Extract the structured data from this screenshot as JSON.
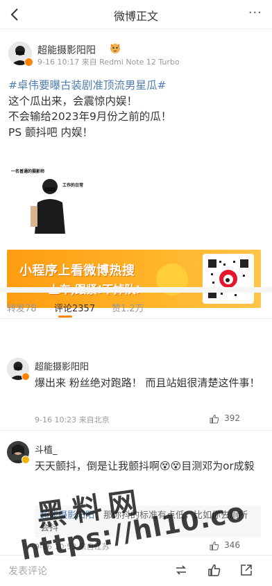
{
  "nav": {
    "title": "微博正文",
    "more": "···"
  },
  "post": {
    "author": "超能摄影阳阳",
    "meta": "9-16 10:17 来自 Redmi Note 12 Turbo",
    "topic": "#卓伟要曝古装剧准顶流男星瓜#",
    "lines": [
      "这个瓜出来，会震惊内娱！",
      "不会输给2023年9月份之前的瓜！",
      "PS 颤抖吧 内娱！"
    ],
    "image_caption_top": "一名普通的摄影师",
    "image_caption_right": "工作的日常"
  },
  "banner": {
    "line1": "小程序上看微博热搜",
    "line2": "上车,跟紧!不掉队!"
  },
  "tabs": {
    "repost": "转发78",
    "comments": "评论2357",
    "likes": "赞1.2万"
  },
  "comments": [
    {
      "name": "超能摄影阳阳",
      "text": "爆出来 粉丝绝对跑路！ 而且站姐很清楚这件事！",
      "meta": "9-16 10:23 来自北京",
      "likes": "392"
    },
    {
      "name": "斗植_",
      "text": "天天颤抖，倒是让我颤抖啊😵😵目测邓为or成毅",
      "meta": "9-16 10:53 来自江苏",
      "likes": "346",
      "reply_name": "超能摄影阳阳",
      "reply_text": "：那你抖的标准有点低，比如你去厕所会抖"
    }
  ],
  "watermark": {
    "line1": "黑料网",
    "line2": "https://hl10.co"
  },
  "bottom": {
    "placeholder": "发表评论"
  }
}
